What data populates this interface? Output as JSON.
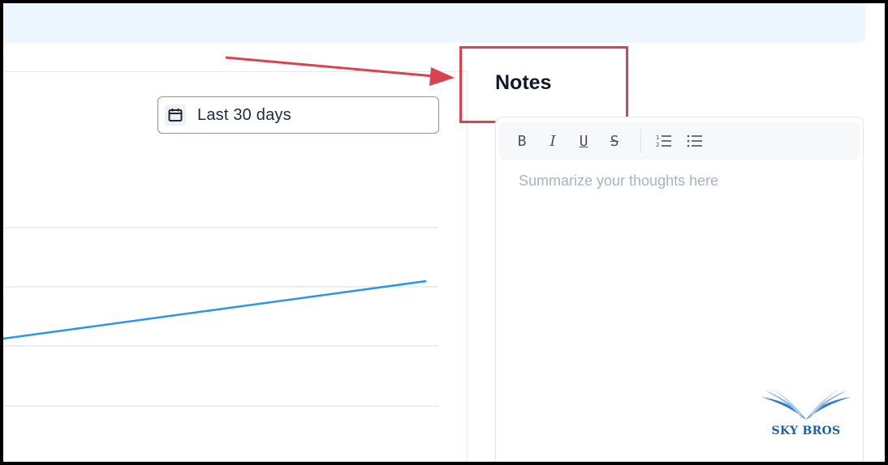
{
  "date_range": {
    "label": "Last 30 days",
    "icon": "calendar-icon"
  },
  "notes": {
    "title": "Notes",
    "placeholder": "Summarize your thoughts here",
    "toolbar": [
      {
        "name": "bold-icon",
        "glyph": "B"
      },
      {
        "name": "italic-icon",
        "glyph": "I"
      },
      {
        "name": "underline-icon",
        "glyph": "U"
      },
      {
        "name": "strikethrough-icon",
        "glyph": "S"
      },
      {
        "name": "ordered-list-icon",
        "glyph": ""
      },
      {
        "name": "bullet-list-icon",
        "glyph": ""
      }
    ]
  },
  "annotation": {
    "highlight_color": "#d9434f"
  },
  "chart": {
    "line_color": "#2b95e9",
    "grid_color": "#e6e9ee"
  },
  "watermark": {
    "text": "SKY BROS",
    "color": "#1a5fb4"
  }
}
